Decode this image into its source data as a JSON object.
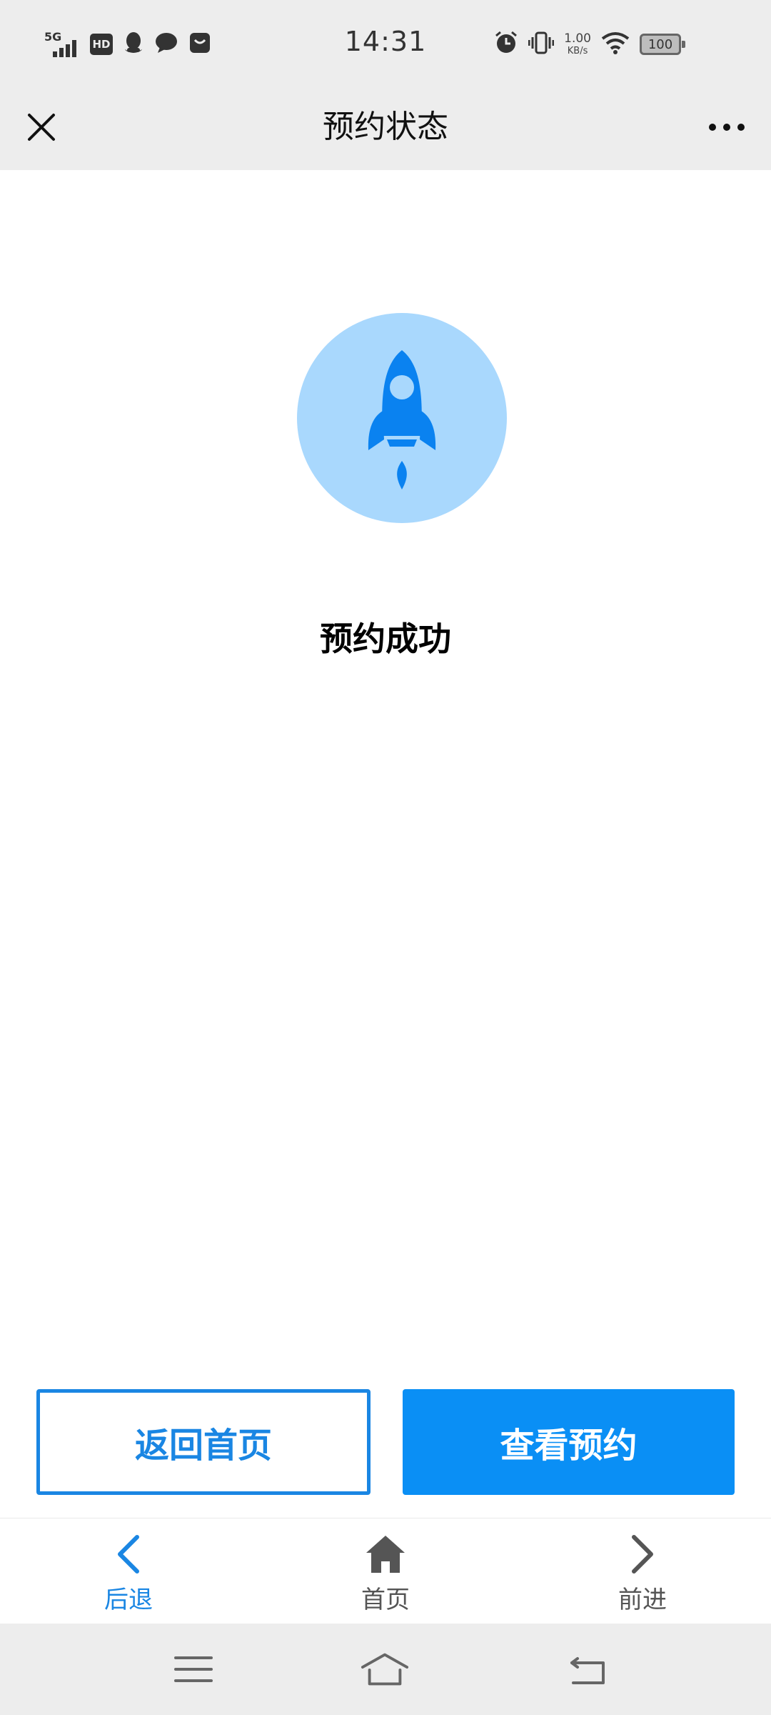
{
  "status_bar": {
    "network": "5G",
    "hd": "HD",
    "time": "14:31",
    "net_speed_value": "1.00",
    "net_speed_unit": "KB/s",
    "battery": "100"
  },
  "nav": {
    "title": "预约状态"
  },
  "result": {
    "title": "预约成功"
  },
  "actions": {
    "back_home_label": "返回首页",
    "view_booking_label": "查看预约"
  },
  "tabs": [
    {
      "label": "后退",
      "active": true
    },
    {
      "label": "首页",
      "active": false
    },
    {
      "label": "前进",
      "active": false
    }
  ],
  "colors": {
    "primary": "#0a8ff5",
    "accent_blue": "#1a86e3",
    "badge_bg": "#a9d8fd",
    "bar_bg": "#ededed",
    "inactive_tab": "#555555"
  }
}
